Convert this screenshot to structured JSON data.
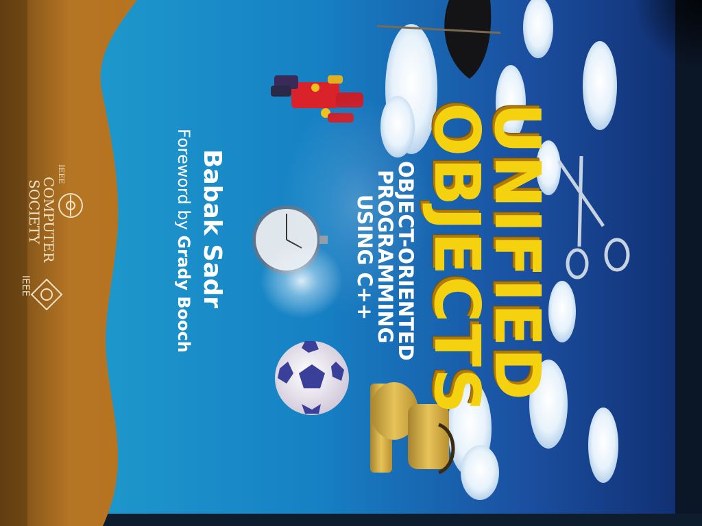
{
  "cover": {
    "title_line1": "UNIFIED",
    "title_line2": "OBJECTS",
    "subtitle_line1": "OBJECT-ORIENTED",
    "subtitle_line2": "PROGRAMMING",
    "subtitle_line3": "USING C++",
    "author": "Babak Sadr",
    "foreword_prefix": "Foreword by ",
    "foreword_name": "Grady Booch"
  },
  "publisher": {
    "small_mark": "IEEE",
    "line1": "COMPUTER",
    "line2": "SOCIETY",
    "ieee_label": "IEEE"
  },
  "colors": {
    "background": "#1a6fb5",
    "spine": "#b8741f",
    "title": "#f5d20f"
  },
  "icons": [
    "umbrella-icon",
    "robot-toy-icon",
    "stopwatch-icon",
    "soccer-ball-icon",
    "scissors-icon",
    "stand-mixer-icon",
    "cloud-icon",
    "computer-society-logo-icon",
    "ieee-diamond-logo-icon"
  ]
}
